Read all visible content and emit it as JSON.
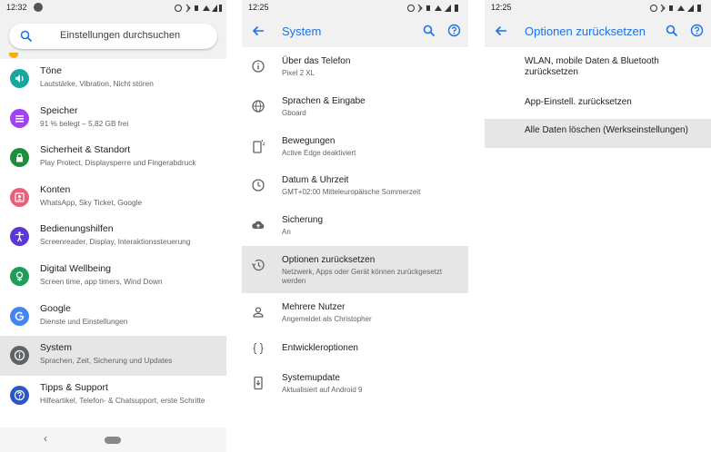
{
  "panel1": {
    "status_time": "12:32",
    "search_placeholder": "Einstellungen durchsuchen",
    "items": [
      {
        "title": "Töne",
        "subtitle": "Lautstärke, Vibration, Nicht stören",
        "icon": "volume-icon",
        "color": "#16a7a0"
      },
      {
        "title": "Speicher",
        "subtitle": "91 % belegt – 5,82 GB frei",
        "icon": "storage-icon",
        "color": "#a142f4"
      },
      {
        "title": "Sicherheit & Standort",
        "subtitle": "Play Protect, Displaysperre und Fingerabdruck",
        "icon": "lock-icon",
        "color": "#1e8e3e"
      },
      {
        "title": "Konten",
        "subtitle": "WhatsApp, Sky Ticket, Google",
        "icon": "account-icon",
        "color": "#e8607a"
      },
      {
        "title": "Bedienungshilfen",
        "subtitle": "Screenreader, Display, Interaktionssteuerung",
        "icon": "accessibility-icon",
        "color": "#5b38d6"
      },
      {
        "title": "Digital Wellbeing",
        "subtitle": "Screen time, app timers, Wind Down",
        "icon": "wellbeing-icon",
        "color": "#1e9e57"
      },
      {
        "title": "Google",
        "subtitle": "Dienste und Einstellungen",
        "icon": "google-icon",
        "color": "#4285f4"
      },
      {
        "title": "System",
        "subtitle": "Sprachen, Zeit, Sicherung und Updates",
        "icon": "info-icon",
        "color": "#5f6368"
      },
      {
        "title": "Tipps & Support",
        "subtitle": "Hilfeartikel, Telefon- & Chatsupport, erste Schritte",
        "icon": "help-icon",
        "color": "#2a56c6"
      }
    ]
  },
  "panel2": {
    "status_time": "12:25",
    "title": "System",
    "items": [
      {
        "title": "Über das Telefon",
        "subtitle": "Pixel 2 XL",
        "icon": "info-icon"
      },
      {
        "title": "Sprachen & Eingabe",
        "subtitle": "Gboard",
        "icon": "globe-icon"
      },
      {
        "title": "Bewegungen",
        "subtitle": "Active Edge deaktiviert",
        "icon": "gesture-phone-icon"
      },
      {
        "title": "Datum & Uhrzeit",
        "subtitle": "GMT+02:00 Mitteleuropäische Sommerzeit",
        "icon": "clock-icon"
      },
      {
        "title": "Sicherung",
        "subtitle": "An",
        "icon": "cloud-upload-icon"
      },
      {
        "title": "Optionen zurücksetzen",
        "subtitle": "Netzwerk, Apps oder Gerät können zurückgesetzt werden",
        "icon": "history-icon"
      },
      {
        "title": "Mehrere Nutzer",
        "subtitle": "Angemeldet als Christopher",
        "icon": "person-icon"
      },
      {
        "title": "Entwickleroptionen",
        "subtitle": "",
        "icon": "braces-icon"
      },
      {
        "title": "Systemupdate",
        "subtitle": "Aktualisiert auf Android 9",
        "icon": "system-update-icon"
      }
    ]
  },
  "panel3": {
    "status_time": "12:25",
    "title": "Optionen zurücksetzen",
    "items": [
      "WLAN, mobile Daten & Bluetooth zurücksetzen",
      "App-Einstell. zurücksetzen",
      "Alle Daten löschen (Werkseinstellungen)"
    ]
  },
  "colors": {
    "accent": "#1a73e8",
    "selected_row": "#e6e6e6",
    "header_bg": "#f1f1f1"
  }
}
